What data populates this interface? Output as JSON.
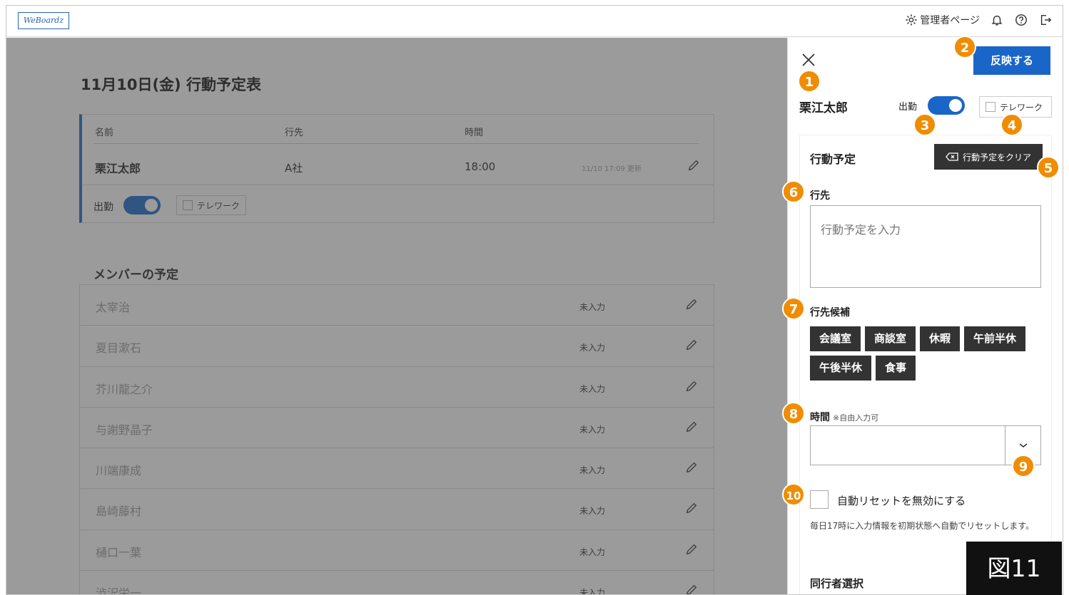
{
  "header": {
    "logo": "WeBoardz",
    "admin_label": "管理者ページ"
  },
  "main": {
    "title": "11月10日(金) 行動予定表",
    "my_card": {
      "col_name": "名前",
      "col_dest": "行先",
      "col_time": "時間",
      "name": "栗江太郎",
      "dest": "A社",
      "time": "18:00",
      "updated": "11/10 17:09 更新",
      "attendance_label": "出勤",
      "telework_label": "テレワーク"
    },
    "members_title": "メンバーの予定",
    "members": [
      {
        "name": "太宰治",
        "status": "未入力"
      },
      {
        "name": "夏目漱石",
        "status": "未入力"
      },
      {
        "name": "芥川龍之介",
        "status": "未入力"
      },
      {
        "name": "与謝野晶子",
        "status": "未入力"
      },
      {
        "name": "川端康成",
        "status": "未入力"
      },
      {
        "name": "島崎藤村",
        "status": "未入力"
      },
      {
        "name": "樋口一葉",
        "status": "未入力"
      },
      {
        "name": "渋沢栄一",
        "status": "未入力"
      }
    ]
  },
  "panel": {
    "apply_label": "反映する",
    "name": "栗江太郎",
    "attendance_label": "出勤",
    "telework_label": "テレワーク",
    "plan_title": "行動予定",
    "clear_label": "行動予定をクリア",
    "dest_label": "行先",
    "dest_placeholder": "行動予定を入力",
    "candidates_label": "行先候補",
    "candidates": [
      "会議室",
      "商談室",
      "休暇",
      "午前半休",
      "午後半休",
      "食事"
    ],
    "time_label": "時間",
    "time_note": "※自由入力可",
    "auto_reset_label": "自動リセットを無効にする",
    "auto_reset_note": "毎日17時に入力情報を初期状態へ自動でリセットします。",
    "companion_label": "同行者選択"
  },
  "annotations": [
    "1",
    "2",
    "3",
    "4",
    "5",
    "6",
    "7",
    "8",
    "9",
    "10"
  ],
  "figure_label": "図11",
  "colors": {
    "accent": "#1a66c8",
    "badge": "#f08c00",
    "chip": "#333333"
  }
}
